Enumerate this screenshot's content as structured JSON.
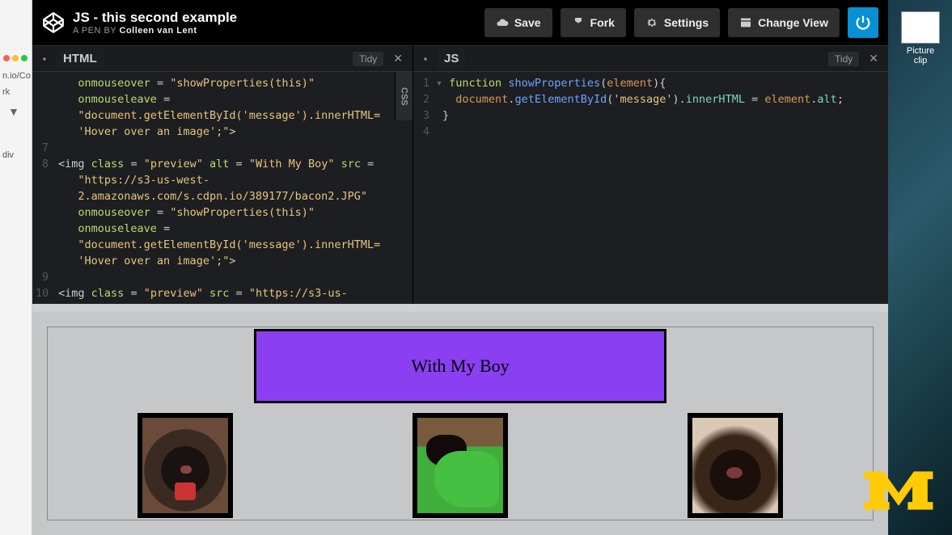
{
  "header": {
    "title": "JS - this second example",
    "byline_prefix": "A PEN BY ",
    "author": "Colleen van Lent",
    "save": "Save",
    "fork": "Fork",
    "settings": "Settings",
    "change_view": "Change View"
  },
  "panes": {
    "html_label": "HTML",
    "js_label": "JS",
    "css_label": "CSS",
    "tidy": "Tidy"
  },
  "html_code": {
    "l6a": "onmouseover = \"showProperties(this)\"",
    "l6b": "onmouseleave =",
    "l6c": "\"document.getElementById('message').innerHTML=",
    "l6d": "'Hover over an image';\">",
    "l8a": "<img class = \"preview\" alt = \"With My Boy\" src =",
    "l8b": "\"https://s3-us-west-2.amazonaws.com/s.cdpn.io/389177/bacon2.JPG\"",
    "l8c": "onmouseover = \"showProperties(this)\"",
    "l8d": "onmouseleave =",
    "l8e": "\"document.getElementById('message').innerHTML=",
    "l8f": "'Hover over an image';\">",
    "l10": "<img class = \"preview\" src = \"https://s3-us-"
  },
  "js_code": {
    "l1": "function showProperties(element){",
    "l2": "document.getElementById('message').innerHTML = element.alt;",
    "l3": "}"
  },
  "output": {
    "message": "With My Boy"
  },
  "desktop": {
    "file_label": "Picture clip"
  },
  "browser": {
    "addr": "n.io/Co",
    "bm1": "rk",
    "bm2": "div"
  }
}
